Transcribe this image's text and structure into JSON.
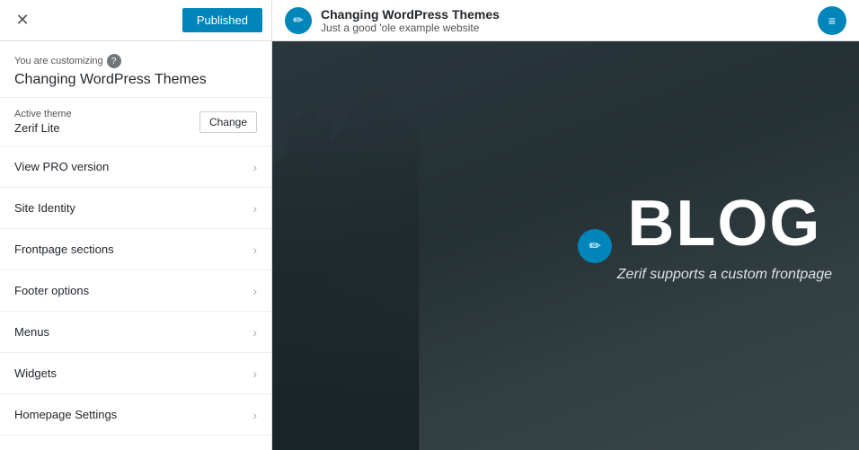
{
  "topBar": {
    "close_label": "✕",
    "published_label": "Published"
  },
  "customizing": {
    "label": "You are customizing",
    "site_name": "Changing WordPress Themes",
    "help_icon": "?"
  },
  "theme": {
    "label": "Active theme",
    "name": "Zerif Lite",
    "change_label": "Change"
  },
  "menu": [
    {
      "label": "View PRO version"
    },
    {
      "label": "Site Identity"
    },
    {
      "label": "Frontpage sections"
    },
    {
      "label": "Footer options"
    },
    {
      "label": "Menus"
    },
    {
      "label": "Widgets"
    },
    {
      "label": "Homepage Settings"
    }
  ],
  "preview": {
    "edit_icon": "✏",
    "site_title": "Changing WordPress Themes",
    "site_tagline": "Just a good 'ole example website",
    "blog_title": "BLOG",
    "blog_subtitle": "Zerif supports a custom frontpage",
    "menu_icon": "≡"
  }
}
